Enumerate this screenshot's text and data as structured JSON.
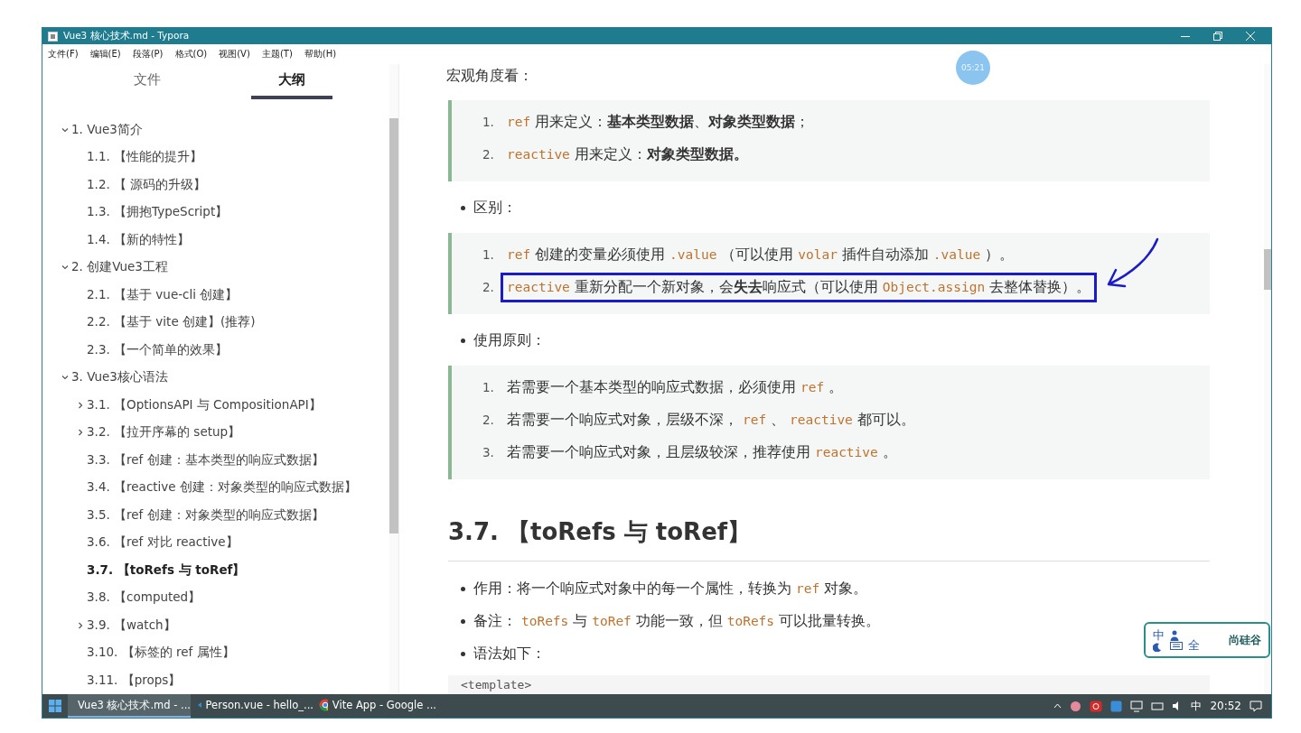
{
  "window": {
    "title": "Vue3 核心技术.md - Typora"
  },
  "menu": [
    "文件(F)",
    "编辑(E)",
    "段落(P)",
    "格式(O)",
    "视图(V)",
    "主题(T)",
    "帮助(H)"
  ],
  "sidebar_tabs": [
    {
      "label": "文件",
      "selected": false
    },
    {
      "label": "大纲",
      "selected": true
    }
  ],
  "outline": [
    {
      "label": "1. Vue3简介",
      "selected": false,
      "expanded": true,
      "children": [
        {
          "label": "1.1. 【性能的提升】",
          "selected": false
        },
        {
          "label": "1.2. 【 源码的升级】",
          "selected": false
        },
        {
          "label": "1.3. 【拥抱TypeScript】",
          "selected": false
        },
        {
          "label": "1.4. 【新的特性】",
          "selected": false
        }
      ]
    },
    {
      "label": "2. 创建Vue3工程",
      "selected": false,
      "expanded": true,
      "children": [
        {
          "label": "2.1. 【基于 vue-cli 创建】",
          "selected": false
        },
        {
          "label": "2.2. 【基于 vite 创建】(推荐)",
          "selected": false
        },
        {
          "label": "2.3. 【一个简单的效果】",
          "selected": false
        }
      ]
    },
    {
      "label": "3. Vue3核心语法",
      "selected": false,
      "expanded": true,
      "children": [
        {
          "label": "3.1. 【OptionsAPI 与 CompositionAPI】",
          "selected": false,
          "expanded": false
        },
        {
          "label": "3.2. 【拉开序幕的 setup】",
          "selected": false,
          "expanded": false
        },
        {
          "label": "3.3. 【ref 创建：基本类型的响应式数据】",
          "selected": false
        },
        {
          "label": "3.4. 【reactive 创建：对象类型的响应式数据】",
          "selected": false
        },
        {
          "label": "3.5. 【ref 创建：对象类型的响应式数据】",
          "selected": false
        },
        {
          "label": "3.6. 【ref 对比 reactive】",
          "selected": false
        },
        {
          "label": "3.7. 【toRefs 与 toRef】",
          "selected": true
        },
        {
          "label": "3.8. 【computed】",
          "selected": false
        },
        {
          "label": "3.9. 【watch】",
          "selected": false,
          "expanded": false
        },
        {
          "label": "3.10. 【标签的 ref 属性】",
          "selected": false
        },
        {
          "label": "3.11. 【props】",
          "selected": false
        }
      ]
    }
  ],
  "document": [
    {
      "kind": "paragraph",
      "parts": [
        {
          "kind": "text",
          "text": "宏观角度看："
        }
      ]
    },
    {
      "kind": "quote",
      "items": [
        {
          "number": "1.",
          "annotated": false,
          "parts": [
            {
              "kind": "code",
              "text": "ref"
            },
            {
              "kind": "text",
              "text": " 用来定义：**基本类型数据**、**对象类型数据**；"
            }
          ]
        },
        {
          "number": "2.",
          "annotated": false,
          "parts": [
            {
              "kind": "code",
              "text": "reactive"
            },
            {
              "kind": "text",
              "text": " 用来定义：**对象类型数据。**"
            }
          ]
        }
      ]
    },
    {
      "kind": "bullet",
      "parts": [
        {
          "kind": "text",
          "text": "区别："
        }
      ]
    },
    {
      "kind": "quote",
      "items": [
        {
          "number": "1.",
          "annotated": false,
          "parts": [
            {
              "kind": "code",
              "text": "ref"
            },
            {
              "kind": "text",
              "text": " 创建的变量必须使用 "
            },
            {
              "kind": "code",
              "text": ".value"
            },
            {
              "kind": "text",
              "text": " （可以使用 "
            },
            {
              "kind": "code",
              "text": "volar"
            },
            {
              "kind": "text",
              "text": " 插件自动添加 "
            },
            {
              "kind": "code",
              "text": ".value"
            },
            {
              "kind": "text",
              "text": " ）。"
            }
          ]
        },
        {
          "number": "2.",
          "annotated": true,
          "parts": [
            {
              "kind": "code",
              "text": "reactive"
            },
            {
              "kind": "text",
              "text": " 重新分配一个新对象，会**失去**响应式（可以使用 "
            },
            {
              "kind": "code",
              "text": "Object.assign"
            },
            {
              "kind": "text",
              "text": " 去整体替换）。"
            }
          ]
        }
      ]
    },
    {
      "kind": "bullet",
      "parts": [
        {
          "kind": "text",
          "text": "使用原则："
        }
      ]
    },
    {
      "kind": "quote",
      "items": [
        {
          "number": "1.",
          "annotated": false,
          "parts": [
            {
              "kind": "text",
              "text": "若需要一个基本类型的响应式数据，必须使用 "
            },
            {
              "kind": "code",
              "text": "ref"
            },
            {
              "kind": "text",
              "text": " 。"
            }
          ]
        },
        {
          "number": "2.",
          "annotated": false,
          "parts": [
            {
              "kind": "text",
              "text": "若需要一个响应式对象，层级不深， "
            },
            {
              "kind": "code",
              "text": "ref"
            },
            {
              "kind": "text",
              "text": " 、 "
            },
            {
              "kind": "code",
              "text": "reactive"
            },
            {
              "kind": "text",
              "text": " 都可以。"
            }
          ]
        },
        {
          "number": "3.",
          "annotated": false,
          "parts": [
            {
              "kind": "text",
              "text": "若需要一个响应式对象，且层级较深，推荐使用 "
            },
            {
              "kind": "code",
              "text": "reactive"
            },
            {
              "kind": "text",
              "text": " 。"
            }
          ]
        }
      ]
    },
    {
      "kind": "heading",
      "parts": [
        {
          "kind": "text",
          "text": "3.7. 【toRefs 与 toRef】"
        }
      ]
    },
    {
      "kind": "bullet",
      "parts": [
        {
          "kind": "text",
          "text": "作用：将一个响应式对象中的每一个属性，转换为 "
        },
        {
          "kind": "code",
          "text": "ref"
        },
        {
          "kind": "text",
          "text": " 对象。"
        }
      ]
    },
    {
      "kind": "bullet",
      "parts": [
        {
          "kind": "text",
          "text": "备注： "
        },
        {
          "kind": "code",
          "text": "toRefs"
        },
        {
          "kind": "text",
          "text": " 与 "
        },
        {
          "kind": "code",
          "text": "toRef"
        },
        {
          "kind": "text",
          "text": " 功能一致，但 "
        },
        {
          "kind": "code",
          "text": "toRefs"
        },
        {
          "kind": "text",
          "text": " 可以批量转换。"
        }
      ]
    },
    {
      "kind": "bullet",
      "parts": [
        {
          "kind": "text",
          "text": "语法如下："
        }
      ]
    },
    {
      "kind": "code_block",
      "text": "<template>"
    }
  ],
  "timer": "05:21",
  "ime_bar": {
    "mode": "中",
    "width": "全",
    "brand": "尚硅谷"
  },
  "taskbar": {
    "apps": [
      {
        "label": "Vue3 核心技术.md - ...",
        "selected": true,
        "kind": "typora"
      },
      {
        "label": "Person.vue - hello_...",
        "selected": false,
        "kind": "vscode"
      },
      {
        "label": "Vite App - Google ...",
        "selected": false,
        "kind": "chrome"
      }
    ],
    "tray_input": "中",
    "time": "20:52"
  }
}
